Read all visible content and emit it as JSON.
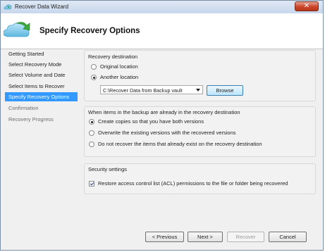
{
  "window": {
    "title": "Recover Data Wizard",
    "close_icon": "close-icon"
  },
  "header": {
    "title": "Specify Recovery Options",
    "icon": "cloud-recovery-icon"
  },
  "nav": {
    "items": [
      {
        "label": "Getting Started",
        "state": "normal"
      },
      {
        "label": "Select Recovery Mode",
        "state": "normal"
      },
      {
        "label": "Select Volume and Date",
        "state": "normal"
      },
      {
        "label": "Select Items to Recover",
        "state": "normal"
      },
      {
        "label": "Specify Recovery Options",
        "state": "selected"
      },
      {
        "label": "Confirmation",
        "state": "disabled"
      },
      {
        "label": "Recovery Progress",
        "state": "disabled"
      }
    ]
  },
  "destination": {
    "heading": "Recovery destination",
    "original_label": "Original location",
    "another_label": "Another location",
    "selected": "another",
    "path_value": "C:\\Recover Data from Backup vault",
    "browse_label": "Browse"
  },
  "conflict": {
    "heading": "When items in the backup are already in the recovery destination",
    "options": [
      "Create copies so that you have both versions",
      "Overwrite the existing versions with the recovered versions",
      "Do not recover the items that already exist on the recovery destination"
    ],
    "selected_index": 0
  },
  "security": {
    "heading": "Security settings",
    "acl_label": "Restore access control list (ACL) permissions to the file or folder being recovered",
    "acl_checked": true
  },
  "footer": {
    "previous_label": "< Previous",
    "next_label": "Next >",
    "recover_label": "Recover",
    "cancel_label": "Cancel",
    "recover_enabled": false
  },
  "colors": {
    "selection": "#3399ff",
    "close_button": "#c9462b"
  }
}
